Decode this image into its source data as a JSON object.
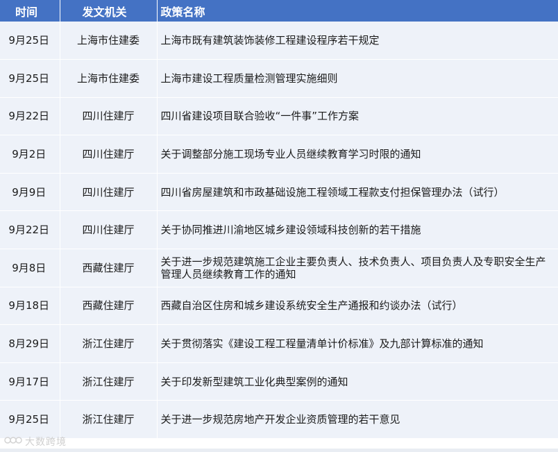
{
  "headers": {
    "time": "时间",
    "org": "发文机关",
    "name": "政策名称"
  },
  "rows": [
    {
      "time": "9月25日",
      "org": "上海市住建委",
      "name": "上海市既有建筑装饰装修工程建设程序若干规定"
    },
    {
      "time": "9月25日",
      "org": "上海市住建委",
      "name": "上海市建设工程质量检测管理实施细则"
    },
    {
      "time": "9月22日",
      "org": "四川住建厅",
      "name": "四川省建设项目联合验收“一件事”工作方案"
    },
    {
      "time": "9月2日",
      "org": "四川住建厅",
      "name": "关于调整部分施工现场专业人员继续教育学习时限的通知"
    },
    {
      "time": "9月9日",
      "org": "四川住建厅",
      "name": "四川省房屋建筑和市政基础设施工程领域工程款支付担保管理办法（试行）"
    },
    {
      "time": "9月22日",
      "org": "四川住建厅",
      "name": "关于协同推进川渝地区城乡建设领域科技创新的若干措施"
    },
    {
      "time": "9月8日",
      "org": "西藏住建厅",
      "name": "关于进一步规范建筑施工企业主要负责人、技术负责人、项目负责人及专职安全生产管理人员继续教育工作的通知"
    },
    {
      "time": "9月18日",
      "org": "西藏住建厅",
      "name": "西藏自治区住房和城乡建设系统安全生产通报和约谈办法（试行）"
    },
    {
      "time": "8月29日",
      "org": "浙江住建厅",
      "name": "关于贯彻落实《建设工程工程量清单计价标准》及九部计算标准的通知"
    },
    {
      "time": "9月17日",
      "org": "浙江住建厅",
      "name": "关于印发新型建筑工业化典型案例的通知"
    },
    {
      "time": "9月25日",
      "org": "浙江住建厅",
      "name": "关于进一步规范房地产开发企业资质管理的若干意见"
    }
  ],
  "watermark": {
    "text": "大数跨境",
    "icon": "logo-icon"
  },
  "colors": {
    "header_bg": "#4472c4",
    "row_bg": "#eef2f9"
  }
}
